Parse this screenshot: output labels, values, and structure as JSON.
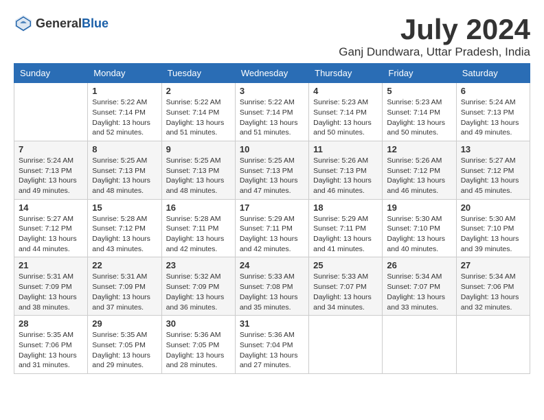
{
  "header": {
    "logo_general": "General",
    "logo_blue": "Blue",
    "month_year": "July 2024",
    "location": "Ganj Dundwara, Uttar Pradesh, India"
  },
  "weekdays": [
    "Sunday",
    "Monday",
    "Tuesday",
    "Wednesday",
    "Thursday",
    "Friday",
    "Saturday"
  ],
  "weeks": [
    [
      {
        "date": "",
        "sunrise": "",
        "sunset": "",
        "daylight": ""
      },
      {
        "date": "1",
        "sunrise": "Sunrise: 5:22 AM",
        "sunset": "Sunset: 7:14 PM",
        "daylight": "Daylight: 13 hours and 52 minutes."
      },
      {
        "date": "2",
        "sunrise": "Sunrise: 5:22 AM",
        "sunset": "Sunset: 7:14 PM",
        "daylight": "Daylight: 13 hours and 51 minutes."
      },
      {
        "date": "3",
        "sunrise": "Sunrise: 5:22 AM",
        "sunset": "Sunset: 7:14 PM",
        "daylight": "Daylight: 13 hours and 51 minutes."
      },
      {
        "date": "4",
        "sunrise": "Sunrise: 5:23 AM",
        "sunset": "Sunset: 7:14 PM",
        "daylight": "Daylight: 13 hours and 50 minutes."
      },
      {
        "date": "5",
        "sunrise": "Sunrise: 5:23 AM",
        "sunset": "Sunset: 7:14 PM",
        "daylight": "Daylight: 13 hours and 50 minutes."
      },
      {
        "date": "6",
        "sunrise": "Sunrise: 5:24 AM",
        "sunset": "Sunset: 7:13 PM",
        "daylight": "Daylight: 13 hours and 49 minutes."
      }
    ],
    [
      {
        "date": "7",
        "sunrise": "Sunrise: 5:24 AM",
        "sunset": "Sunset: 7:13 PM",
        "daylight": "Daylight: 13 hours and 49 minutes."
      },
      {
        "date": "8",
        "sunrise": "Sunrise: 5:25 AM",
        "sunset": "Sunset: 7:13 PM",
        "daylight": "Daylight: 13 hours and 48 minutes."
      },
      {
        "date": "9",
        "sunrise": "Sunrise: 5:25 AM",
        "sunset": "Sunset: 7:13 PM",
        "daylight": "Daylight: 13 hours and 48 minutes."
      },
      {
        "date": "10",
        "sunrise": "Sunrise: 5:25 AM",
        "sunset": "Sunset: 7:13 PM",
        "daylight": "Daylight: 13 hours and 47 minutes."
      },
      {
        "date": "11",
        "sunrise": "Sunrise: 5:26 AM",
        "sunset": "Sunset: 7:13 PM",
        "daylight": "Daylight: 13 hours and 46 minutes."
      },
      {
        "date": "12",
        "sunrise": "Sunrise: 5:26 AM",
        "sunset": "Sunset: 7:12 PM",
        "daylight": "Daylight: 13 hours and 46 minutes."
      },
      {
        "date": "13",
        "sunrise": "Sunrise: 5:27 AM",
        "sunset": "Sunset: 7:12 PM",
        "daylight": "Daylight: 13 hours and 45 minutes."
      }
    ],
    [
      {
        "date": "14",
        "sunrise": "Sunrise: 5:27 AM",
        "sunset": "Sunset: 7:12 PM",
        "daylight": "Daylight: 13 hours and 44 minutes."
      },
      {
        "date": "15",
        "sunrise": "Sunrise: 5:28 AM",
        "sunset": "Sunset: 7:12 PM",
        "daylight": "Daylight: 13 hours and 43 minutes."
      },
      {
        "date": "16",
        "sunrise": "Sunrise: 5:28 AM",
        "sunset": "Sunset: 7:11 PM",
        "daylight": "Daylight: 13 hours and 42 minutes."
      },
      {
        "date": "17",
        "sunrise": "Sunrise: 5:29 AM",
        "sunset": "Sunset: 7:11 PM",
        "daylight": "Daylight: 13 hours and 42 minutes."
      },
      {
        "date": "18",
        "sunrise": "Sunrise: 5:29 AM",
        "sunset": "Sunset: 7:11 PM",
        "daylight": "Daylight: 13 hours and 41 minutes."
      },
      {
        "date": "19",
        "sunrise": "Sunrise: 5:30 AM",
        "sunset": "Sunset: 7:10 PM",
        "daylight": "Daylight: 13 hours and 40 minutes."
      },
      {
        "date": "20",
        "sunrise": "Sunrise: 5:30 AM",
        "sunset": "Sunset: 7:10 PM",
        "daylight": "Daylight: 13 hours and 39 minutes."
      }
    ],
    [
      {
        "date": "21",
        "sunrise": "Sunrise: 5:31 AM",
        "sunset": "Sunset: 7:09 PM",
        "daylight": "Daylight: 13 hours and 38 minutes."
      },
      {
        "date": "22",
        "sunrise": "Sunrise: 5:31 AM",
        "sunset": "Sunset: 7:09 PM",
        "daylight": "Daylight: 13 hours and 37 minutes."
      },
      {
        "date": "23",
        "sunrise": "Sunrise: 5:32 AM",
        "sunset": "Sunset: 7:09 PM",
        "daylight": "Daylight: 13 hours and 36 minutes."
      },
      {
        "date": "24",
        "sunrise": "Sunrise: 5:33 AM",
        "sunset": "Sunset: 7:08 PM",
        "daylight": "Daylight: 13 hours and 35 minutes."
      },
      {
        "date": "25",
        "sunrise": "Sunrise: 5:33 AM",
        "sunset": "Sunset: 7:07 PM",
        "daylight": "Daylight: 13 hours and 34 minutes."
      },
      {
        "date": "26",
        "sunrise": "Sunrise: 5:34 AM",
        "sunset": "Sunset: 7:07 PM",
        "daylight": "Daylight: 13 hours and 33 minutes."
      },
      {
        "date": "27",
        "sunrise": "Sunrise: 5:34 AM",
        "sunset": "Sunset: 7:06 PM",
        "daylight": "Daylight: 13 hours and 32 minutes."
      }
    ],
    [
      {
        "date": "28",
        "sunrise": "Sunrise: 5:35 AM",
        "sunset": "Sunset: 7:06 PM",
        "daylight": "Daylight: 13 hours and 31 minutes."
      },
      {
        "date": "29",
        "sunrise": "Sunrise: 5:35 AM",
        "sunset": "Sunset: 7:05 PM",
        "daylight": "Daylight: 13 hours and 29 minutes."
      },
      {
        "date": "30",
        "sunrise": "Sunrise: 5:36 AM",
        "sunset": "Sunset: 7:05 PM",
        "daylight": "Daylight: 13 hours and 28 minutes."
      },
      {
        "date": "31",
        "sunrise": "Sunrise: 5:36 AM",
        "sunset": "Sunset: 7:04 PM",
        "daylight": "Daylight: 13 hours and 27 minutes."
      },
      {
        "date": "",
        "sunrise": "",
        "sunset": "",
        "daylight": ""
      },
      {
        "date": "",
        "sunrise": "",
        "sunset": "",
        "daylight": ""
      },
      {
        "date": "",
        "sunrise": "",
        "sunset": "",
        "daylight": ""
      }
    ]
  ]
}
